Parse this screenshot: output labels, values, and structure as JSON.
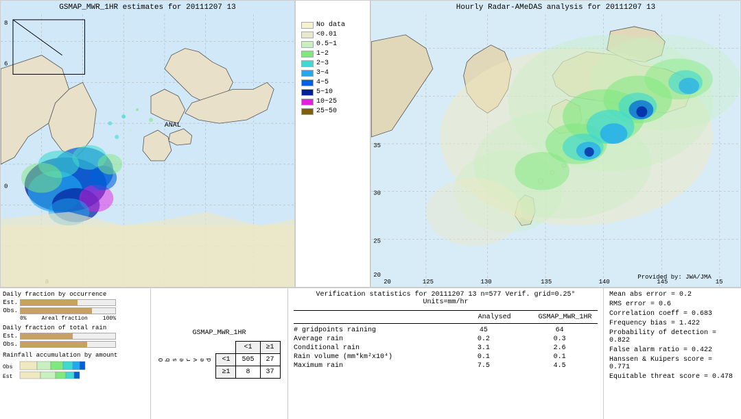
{
  "left_map": {
    "title": "GSMAP_MWR_1HR estimates for 20111207 13",
    "anal_label": "ANAL",
    "anal_x": "56%",
    "anal_y": "43%"
  },
  "right_map": {
    "title": "Hourly Radar-AMeDAS analysis for 20111207 13",
    "provided_label": "Provided by: JWA/JMA"
  },
  "legend": {
    "items": [
      {
        "label": "No data",
        "color": "#f5f0d0"
      },
      {
        "label": "<0.01",
        "color": "#e8e8d0"
      },
      {
        "label": "0.5~1",
        "color": "#c8f0c0"
      },
      {
        "label": "1~2",
        "color": "#80e880"
      },
      {
        "label": "2~3",
        "color": "#40d8d0"
      },
      {
        "label": "3~4",
        "color": "#20a8f0"
      },
      {
        "label": "4~5",
        "color": "#0060d8"
      },
      {
        "label": "5~10",
        "color": "#0020a0"
      },
      {
        "label": "10~25",
        "color": "#e020e0"
      },
      {
        "label": "25~50",
        "color": "#806010"
      }
    ]
  },
  "charts": {
    "title1": "Daily fraction by occurrence",
    "est_label": "Est.",
    "obs_label": "Obs.",
    "axis_left": "0%",
    "axis_right": "100%",
    "axis_mid": "Areal fraction",
    "title2": "Daily fraction of total rain",
    "title3": "Rainfall accumulation by amount",
    "est_bar1_width": 60,
    "obs_bar1_width": 75,
    "est_bar2_width": 55,
    "obs_bar2_width": 70
  },
  "contingency": {
    "title": "GSMAP_MWR_1HR",
    "col_lt1": "<1",
    "col_ge1": "≥1",
    "row_lt1": "<1",
    "row_ge1": "≥1",
    "observed_label": "O\nb\ns\ne\nr\nv\ne\nd",
    "v11": "505",
    "v12": "27",
    "v21": "8",
    "v22": "37"
  },
  "verification": {
    "title": "Verification statistics for 20111207 13  n=577  Verif. grid=0.25°  Units=mm/hr",
    "col1": "Analysed",
    "col2": "GSMAP_MWR_1HR",
    "rows": [
      {
        "name": "# gridpoints raining",
        "val1": "45",
        "val2": "64"
      },
      {
        "name": "Average rain",
        "val1": "0.2",
        "val2": "0.3"
      },
      {
        "name": "Conditional rain",
        "val1": "3.1",
        "val2": "2.6"
      },
      {
        "name": "Rain volume (mm*km²x10⁴)",
        "val1": "0.1",
        "val2": "0.1"
      },
      {
        "name": "Maximum rain",
        "val1": "7.5",
        "val2": "4.5"
      }
    ]
  },
  "right_stats": {
    "rows": [
      "Mean abs error = 0.2",
      "RMS error = 0.6",
      "Correlation coeff = 0.683",
      "Frequency bias = 1.422",
      "Probability of detection = 0.822",
      "False alarm ratio = 0.422",
      "Hanssen & Kuipers score = 0.771",
      "Equitable threat score = 0.478"
    ]
  }
}
